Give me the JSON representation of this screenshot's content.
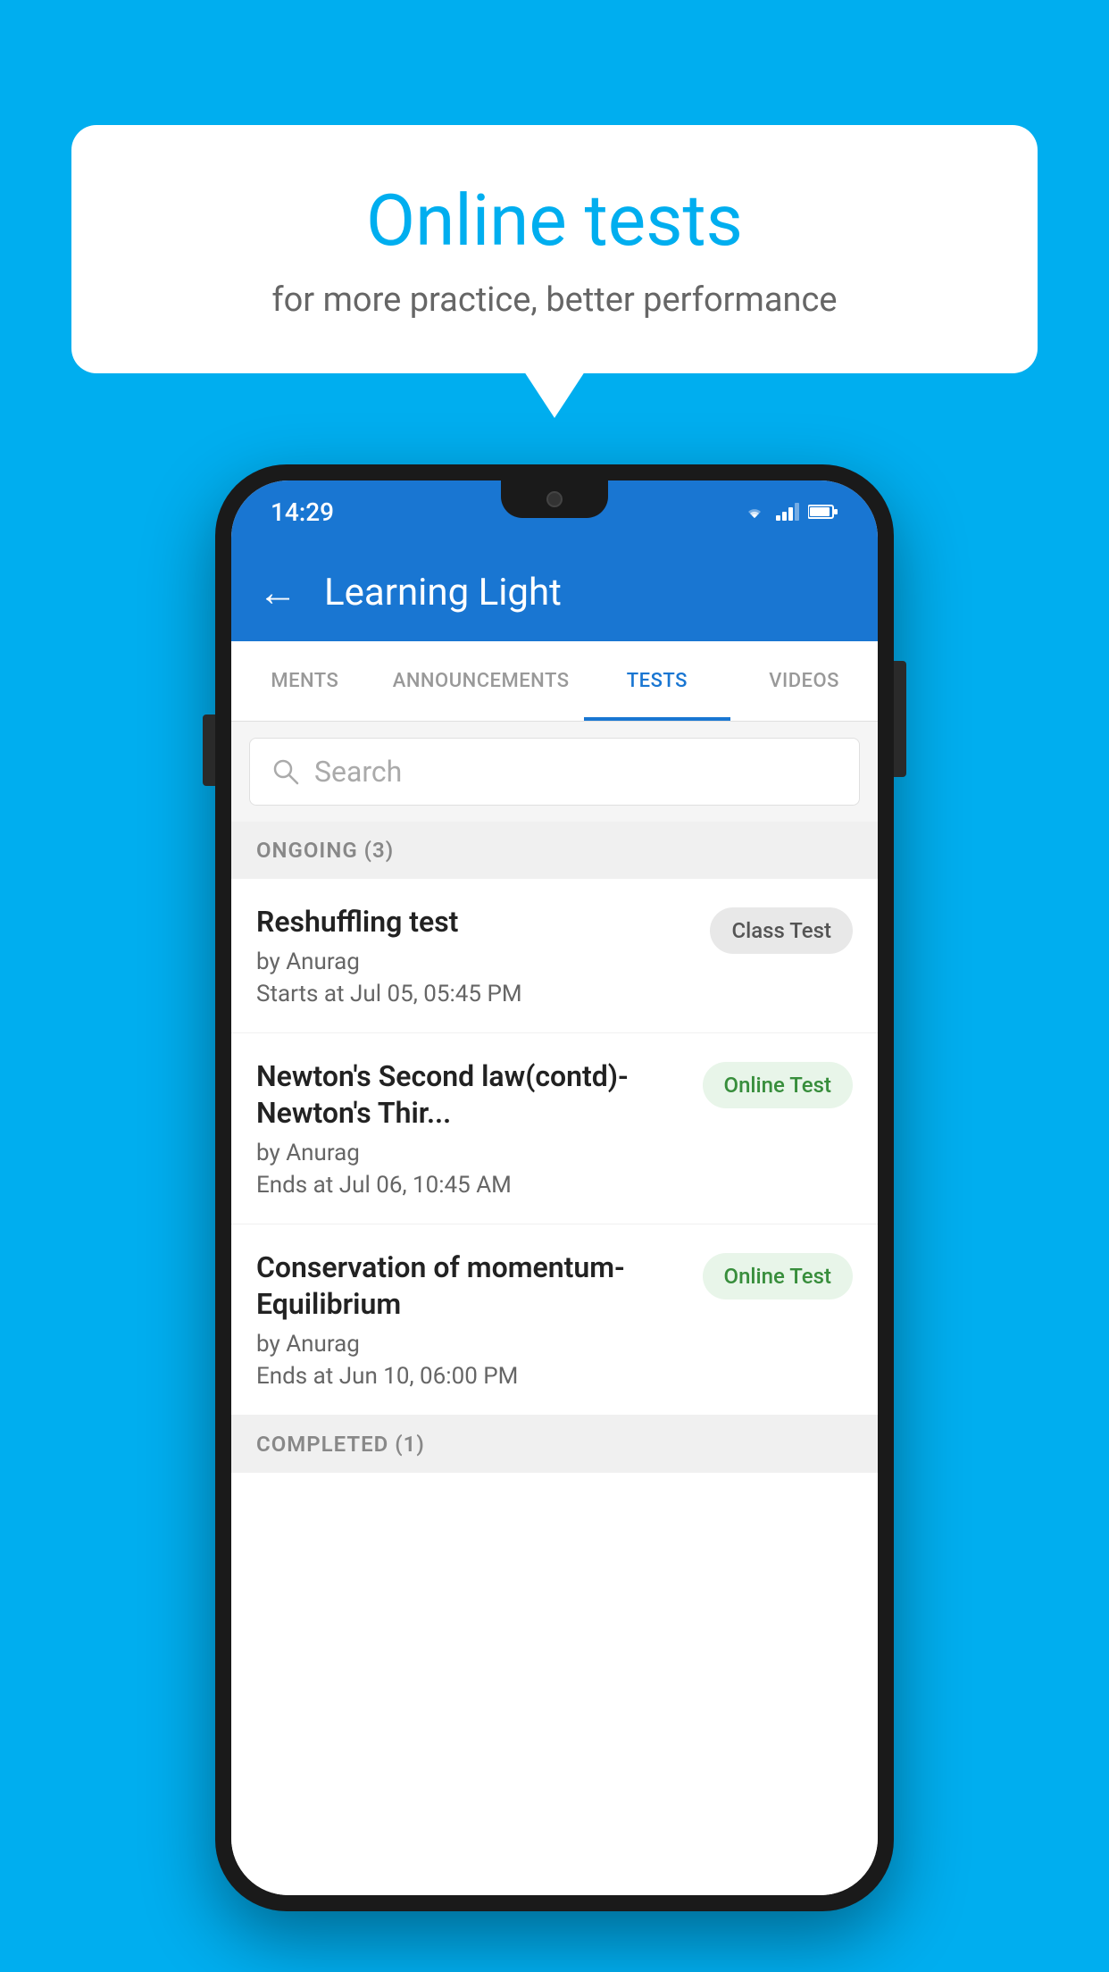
{
  "background": {
    "color": "#00AEEF"
  },
  "speech_bubble": {
    "title": "Online tests",
    "subtitle": "for more practice, better performance"
  },
  "phone": {
    "status_bar": {
      "time": "14:29"
    },
    "app_bar": {
      "title": "Learning Light",
      "back_label": "←"
    },
    "tabs": [
      {
        "id": "ments",
        "label": "MENTS",
        "active": false
      },
      {
        "id": "announcements",
        "label": "ANNOUNCEMENTS",
        "active": false
      },
      {
        "id": "tests",
        "label": "TESTS",
        "active": true
      },
      {
        "id": "videos",
        "label": "VIDEOS",
        "active": false
      }
    ],
    "search": {
      "placeholder": "Search"
    },
    "ongoing_section": {
      "label": "ONGOING (3)"
    },
    "tests": [
      {
        "id": "reshuffling",
        "name": "Reshuffling test",
        "author": "by Anurag",
        "time_label": "Starts at",
        "time_value": "Jul 05, 05:45 PM",
        "badge": "Class Test",
        "badge_type": "class"
      },
      {
        "id": "newtons-second",
        "name": "Newton's Second law(contd)-Newton's Thir...",
        "author": "by Anurag",
        "time_label": "Ends at",
        "time_value": "Jul 06, 10:45 AM",
        "badge": "Online Test",
        "badge_type": "online"
      },
      {
        "id": "conservation",
        "name": "Conservation of momentum-Equilibrium",
        "author": "by Anurag",
        "time_label": "Ends at",
        "time_value": "Jun 10, 06:00 PM",
        "badge": "Online Test",
        "badge_type": "online"
      }
    ],
    "completed_section": {
      "label": "COMPLETED (1)"
    }
  }
}
